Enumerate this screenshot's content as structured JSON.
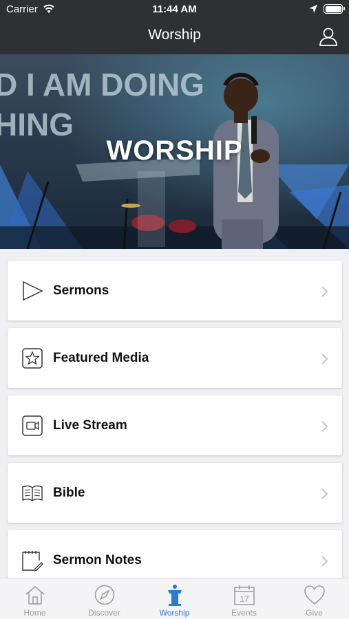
{
  "status_bar": {
    "carrier": "Carrier",
    "time": "11:44 AM"
  },
  "nav": {
    "title": "Worship",
    "profile_icon": "person-icon"
  },
  "hero": {
    "title": "WORSHIP",
    "backdrop_text": [
      "D I AM DOING",
      "HING"
    ]
  },
  "menu": [
    {
      "label": "Sermons",
      "icon": "play-icon"
    },
    {
      "label": "Featured Media",
      "icon": "star-icon"
    },
    {
      "label": "Live Stream",
      "icon": "video-icon"
    },
    {
      "label": "Bible",
      "icon": "book-icon"
    },
    {
      "label": "Sermon Notes",
      "icon": "notes-icon"
    }
  ],
  "tabs": [
    {
      "label": "Home",
      "icon": "home-icon",
      "active": false
    },
    {
      "label": "Discover",
      "icon": "compass-icon",
      "active": false
    },
    {
      "label": "Worship",
      "icon": "pulpit-icon",
      "active": true
    },
    {
      "label": "Events",
      "icon": "calendar-icon",
      "active": false,
      "calendar_day": "17"
    },
    {
      "label": "Give",
      "icon": "heart-icon",
      "active": false
    }
  ],
  "colors": {
    "topbar": "#2e3033",
    "accent": "#2d7bd0",
    "tab_inactive": "#9a9a9e",
    "background": "#efeff4"
  }
}
